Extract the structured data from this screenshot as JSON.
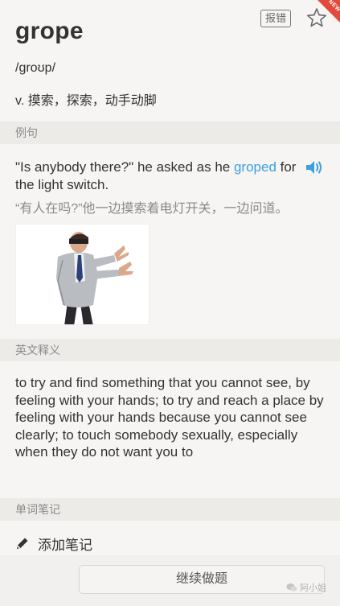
{
  "entry": {
    "word": "grope",
    "report_label": "报错",
    "new_badge": "NEW",
    "phonetic": "/ɡroʊp/",
    "definition_cn": "v. 摸索，探索，动手动脚"
  },
  "example": {
    "section_label": "例句",
    "sentence_before": "\"Is anybody there?\" he asked as he ",
    "sentence_highlight": "groped",
    "sentence_after": " for the light switch.",
    "translation": "“有人在吗?”他一边摸索着电灯开关，一边问道。"
  },
  "english_definition": {
    "section_label": "英文释义",
    "text": "to try and find something that you cannot see, by feeling with your hands; to try and reach a place by feeling with your hands because you cannot see clearly; to touch somebody sexually, especially when they do not want you to"
  },
  "notes": {
    "section_label": "单词笔记",
    "add_note_label": "添加笔记"
  },
  "footer": {
    "continue_label": "继续做题",
    "watermark": "阿小姐"
  },
  "colors": {
    "accent": "#3aa0e0",
    "badge": "#e34a3c",
    "section_bg": "#ecebe8"
  },
  "icons": {
    "star": "star-icon",
    "speaker": "speaker-icon",
    "pencil": "pencil-icon"
  }
}
